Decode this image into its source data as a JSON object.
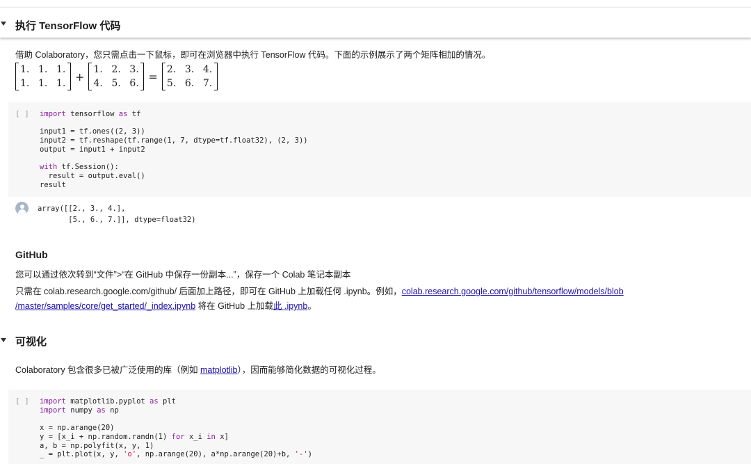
{
  "section1": {
    "title": "执行 TensorFlow 代码",
    "intro": "借助 Colaboratory，您只需点击一下鼠标，即可在浏览器中执行 TensorFlow 代码。下面的示例展示了两个矩阵相加的情况。",
    "matrix_a": [
      [
        "1.",
        "1.",
        "1."
      ],
      [
        "1.",
        "1.",
        "1."
      ]
    ],
    "matrix_b": [
      [
        "1.",
        "2.",
        "3."
      ],
      [
        "4.",
        "5.",
        "6."
      ]
    ],
    "matrix_c": [
      [
        "2.",
        "3.",
        "4."
      ],
      [
        "5.",
        "6.",
        "7."
      ]
    ],
    "plus": "+",
    "equals": "=",
    "cell": {
      "run_label": "[ ]",
      "lines": [
        "import tensorflow as tf",
        "",
        "input1 = tf.ones((2, 3))",
        "input2 = tf.reshape(tf.range(1, 7, dtype=tf.float32), (2, 3))",
        "output = input1 + input2",
        "",
        "with tf.Session():",
        "  result = output.eval()",
        "result"
      ]
    },
    "output_lines": [
      "array([[2., 3., 4.],",
      "       [5., 6., 7.]], dtype=float32)"
    ]
  },
  "github": {
    "title": "GitHub",
    "line1": "您可以通过依次转到“文件”>“在 GitHub 中保存一份副本...”，保存一个 Colab 笔记本副本",
    "line2_prefix": "只需在 colab.research.google.com/github/ 后面加上路径，即可在 GitHub 上加载任何 .ipynb。例如，",
    "line2_link": "colab.research.google.com/github/tensorflow/models/blob",
    "line3_link": "/master/samples/core/get_started/_index.ipynb",
    "line3_middle": " 将在 GitHub 上加载",
    "line3_link2": "此 .ipynb",
    "line3_end": "。"
  },
  "section2": {
    "title": "可视化",
    "intro_prefix": "Colaboratory 包含很多已被广泛使用的库（例如 ",
    "intro_link": "matplotlib",
    "intro_suffix": "），因而能够简化数据的可视化过程。",
    "cell": {
      "run_label": "[ ]",
      "lines": [
        "import matplotlib.pyplot as plt",
        "import numpy as np",
        "",
        "x = np.arange(20)",
        "y = [x_i + np.random.randn(1) for x_i in x]",
        "a, b = np.polyfit(x, y, 1)",
        "_ = plt.plot(x, y, 'o', np.arange(20), a*np.arange(20)+b, '-')"
      ]
    }
  }
}
